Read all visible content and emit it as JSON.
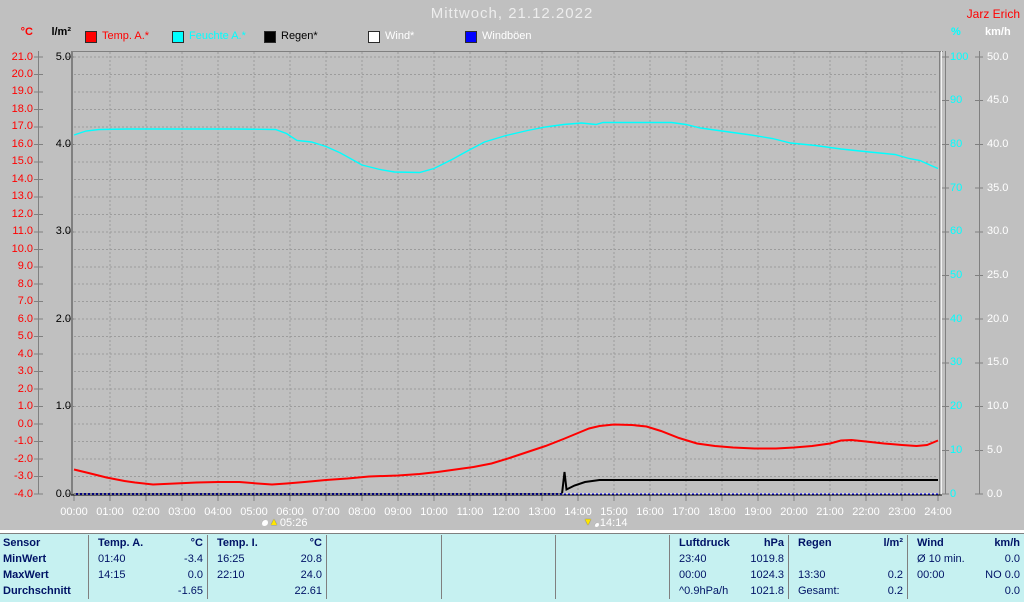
{
  "window": {
    "title_date": "Mittwoch, 21.12.2022",
    "station_label": "Jarz Erich"
  },
  "axis_units": {
    "left_temp": "°C",
    "left_rain": "l/m²",
    "right_humidity": "%",
    "right_wind": "km/h"
  },
  "legend": {
    "items": [
      {
        "label": "Temp. A.*",
        "swatch_color": "#ff0000",
        "text_color": "#ff0000"
      },
      {
        "label": "Feuchte A.*",
        "swatch_color": "#00ffff",
        "text_color": "#00ffff"
      },
      {
        "label": "Regen*",
        "swatch_color": "#000000",
        "text_color": "#000000"
      },
      {
        "label": "Wind*",
        "swatch_color": "#ffffff",
        "text_color": "#ffffff"
      },
      {
        "label": "Windböen",
        "swatch_color": "#0000ff",
        "text_color": "#ffffff"
      }
    ]
  },
  "markers": {
    "moonrise": {
      "time": "05:26"
    },
    "moonset": {
      "time": "14:14"
    }
  },
  "chart_data": {
    "type": "line",
    "title": "Mittwoch, 21.12.2022",
    "grid": true,
    "x_axis": {
      "unit": "time",
      "min_hour": 0,
      "max_hour": 24,
      "tick_labels": [
        "00:00",
        "01:00",
        "02:00",
        "03:00",
        "04:00",
        "05:00",
        "06:00",
        "07:00",
        "08:00",
        "09:00",
        "10:00",
        "11:00",
        "12:00",
        "13:00",
        "14:00",
        "15:00",
        "16:00",
        "17:00",
        "18:00",
        "19:00",
        "20:00",
        "21:00",
        "22:00",
        "23:00",
        "24:00"
      ]
    },
    "axes": {
      "temp_c": {
        "side": "left",
        "unit": "°C",
        "color": "#ff0000",
        "min": -4,
        "max": 21,
        "ticks": [
          "21.0",
          "20.0",
          "19.0",
          "18.0",
          "17.0",
          "16.0",
          "15.0",
          "14.0",
          "13.0",
          "12.0",
          "11.0",
          "10.0",
          "9.0",
          "8.0",
          "7.0",
          "6.0",
          "5.0",
          "4.0",
          "3.0",
          "2.0",
          "1.0",
          "0.0",
          "-1.0",
          "-2.0",
          "-3.0",
          "-4.0"
        ]
      },
      "rain_lm2": {
        "side": "left",
        "unit": "l/m²",
        "color": "#000000",
        "min": 0,
        "max": 5,
        "ticks": [
          "5.0",
          "4.0",
          "3.0",
          "2.0",
          "1.0",
          "0.0"
        ]
      },
      "humidity_pct": {
        "side": "right",
        "unit": "%",
        "color": "#00ffff",
        "min": 0,
        "max": 100,
        "ticks": [
          "100",
          "90",
          "80",
          "70",
          "60",
          "50",
          "40",
          "30",
          "20",
          "10",
          "0"
        ]
      },
      "wind_kmh": {
        "side": "right",
        "unit": "km/h",
        "color": "#ffffff",
        "min": 0,
        "max": 50,
        "ticks": [
          "50.0",
          "45.0",
          "40.0",
          "35.0",
          "30.0",
          "25.0",
          "20.0",
          "15.0",
          "10.0",
          "5.0",
          "0.0"
        ]
      }
    },
    "series": [
      {
        "name": "Feuchte A.*",
        "axis": "humidity_pct",
        "color": "#00ffff",
        "width": 1.4,
        "points": [
          [
            0,
            82.2
          ],
          [
            0.33,
            83.1
          ],
          [
            0.7,
            83.4
          ],
          [
            1.5,
            83.5
          ],
          [
            2.5,
            83.5
          ],
          [
            3.5,
            83.5
          ],
          [
            4.5,
            83.5
          ],
          [
            5.6,
            83.4
          ],
          [
            5.9,
            82.5
          ],
          [
            6.2,
            80.9
          ],
          [
            6.6,
            80.6
          ],
          [
            7.0,
            79.5
          ],
          [
            7.4,
            78.0
          ],
          [
            8.0,
            75.3
          ],
          [
            8.5,
            74.2
          ],
          [
            8.9,
            73.7
          ],
          [
            9.6,
            73.6
          ],
          [
            10.0,
            74.5
          ],
          [
            10.5,
            76.5
          ],
          [
            10.9,
            78.4
          ],
          [
            11.4,
            80.5
          ],
          [
            12.0,
            82.0
          ],
          [
            12.6,
            83.2
          ],
          [
            13.1,
            84.0
          ],
          [
            13.6,
            84.6
          ],
          [
            14.1,
            84.9
          ],
          [
            14.5,
            84.5
          ],
          [
            14.7,
            85.0
          ],
          [
            15.5,
            85.0
          ],
          [
            16.6,
            85.0
          ],
          [
            17.0,
            84.5
          ],
          [
            17.4,
            83.7
          ],
          [
            18.1,
            82.9
          ],
          [
            18.8,
            82.2
          ],
          [
            19.4,
            81.3
          ],
          [
            19.9,
            80.3
          ],
          [
            20.6,
            79.7
          ],
          [
            21.3,
            78.9
          ],
          [
            22.1,
            78.3
          ],
          [
            22.8,
            77.7
          ],
          [
            23.2,
            76.8
          ],
          [
            23.5,
            76.3
          ],
          [
            23.8,
            75.2
          ],
          [
            24,
            74.5
          ]
        ]
      },
      {
        "name": "Temp. A.*",
        "axis": "temp_c",
        "color": "#ff0000",
        "width": 2,
        "points": [
          [
            0,
            -2.6
          ],
          [
            0.4,
            -2.8
          ],
          [
            0.9,
            -3.05
          ],
          [
            1.4,
            -3.25
          ],
          [
            1.7,
            -3.35
          ],
          [
            2.2,
            -3.45
          ],
          [
            2.8,
            -3.4
          ],
          [
            3.4,
            -3.35
          ],
          [
            4.0,
            -3.3
          ],
          [
            4.6,
            -3.3
          ],
          [
            5.1,
            -3.4
          ],
          [
            5.5,
            -3.45
          ],
          [
            5.9,
            -3.4
          ],
          [
            6.4,
            -3.3
          ],
          [
            7.0,
            -3.2
          ],
          [
            7.6,
            -3.1
          ],
          [
            8.2,
            -3.0
          ],
          [
            9.0,
            -2.93
          ],
          [
            9.6,
            -2.85
          ],
          [
            10.1,
            -2.75
          ],
          [
            10.6,
            -2.6
          ],
          [
            11.1,
            -2.45
          ],
          [
            11.6,
            -2.25
          ],
          [
            12.1,
            -1.95
          ],
          [
            12.6,
            -1.6
          ],
          [
            13.1,
            -1.25
          ],
          [
            13.6,
            -0.85
          ],
          [
            14.0,
            -0.5
          ],
          [
            14.3,
            -0.25
          ],
          [
            14.6,
            -0.1
          ],
          [
            15.0,
            -0.03
          ],
          [
            15.5,
            -0.05
          ],
          [
            15.9,
            -0.15
          ],
          [
            16.3,
            -0.4
          ],
          [
            16.8,
            -0.8
          ],
          [
            17.3,
            -1.1
          ],
          [
            17.8,
            -1.25
          ],
          [
            18.3,
            -1.35
          ],
          [
            18.9,
            -1.4
          ],
          [
            19.5,
            -1.4
          ],
          [
            20.0,
            -1.35
          ],
          [
            20.5,
            -1.25
          ],
          [
            21.0,
            -1.1
          ],
          [
            21.3,
            -0.95
          ],
          [
            21.6,
            -0.9
          ],
          [
            22.0,
            -1.0
          ],
          [
            22.5,
            -1.1
          ],
          [
            23.0,
            -1.2
          ],
          [
            23.4,
            -1.25
          ],
          [
            23.7,
            -1.2
          ],
          [
            24,
            -0.95
          ]
        ]
      },
      {
        "name": "Regen*",
        "axis": "rain_lm2",
        "color": "#000000",
        "width": 2,
        "points": [
          [
            0,
            0
          ],
          [
            13.55,
            0
          ],
          [
            13.62,
            0.25
          ],
          [
            13.68,
            0.05
          ],
          [
            13.9,
            0.1
          ],
          [
            14.2,
            0.14
          ],
          [
            14.6,
            0.16
          ],
          [
            15.0,
            0.16
          ],
          [
            24,
            0.16
          ]
        ]
      },
      {
        "name": "Windböen",
        "axis": "wind_kmh",
        "color": "#0000ff",
        "width": 1,
        "points": [
          [
            0,
            0
          ],
          [
            24,
            0
          ]
        ]
      },
      {
        "name": "Wind*",
        "axis": "wind_kmh",
        "color": "#ffffff",
        "width": 1,
        "dash": "2 2",
        "points": [
          [
            0,
            0
          ],
          [
            24,
            0
          ]
        ]
      }
    ],
    "markers": [
      {
        "type": "moonrise",
        "time": "05:26",
        "x_hour": 5.43
      },
      {
        "type": "moonset",
        "time": "14:14",
        "x_hour": 14.23
      }
    ]
  },
  "stats_table": {
    "row_labels": [
      "Sensor",
      "MinWert",
      "MaxWert",
      "Durchschnitt"
    ],
    "columns": [
      {
        "name": "Temp. A.",
        "unit": "°C",
        "min_time": "01:40",
        "min_value": "-3.4",
        "max_time": "14:15",
        "max_value": "0.0",
        "avg_label": "",
        "avg_value": "-1.65"
      },
      {
        "name": "Temp. I.",
        "unit": "°C",
        "min_time": "16:25",
        "min_value": "20.8",
        "max_time": "22:10",
        "max_value": "24.0",
        "avg_label": "",
        "avg_value": "22.61"
      },
      {
        "name": "",
        "unit": "",
        "min_time": "",
        "min_value": "",
        "max_time": "",
        "max_value": "",
        "avg_label": "",
        "avg_value": ""
      },
      {
        "name": "",
        "unit": "",
        "min_time": "",
        "min_value": "",
        "max_time": "",
        "max_value": "",
        "avg_label": "",
        "avg_value": ""
      },
      {
        "name": "",
        "unit": "",
        "min_time": "",
        "min_value": "",
        "max_time": "",
        "max_value": "",
        "avg_label": "",
        "avg_value": ""
      },
      {
        "name": "Luftdruck",
        "unit": "hPa",
        "min_time": "23:40",
        "min_value": "1019.8",
        "max_time": "00:00",
        "max_value": "1024.3",
        "avg_label": "^0.9hPa/h",
        "avg_value": "1021.8"
      },
      {
        "name": "Regen",
        "unit": "l/m²",
        "min_time": "",
        "min_value": "",
        "max_time": "13:30",
        "max_value": "0.2",
        "avg_label": "Gesamt:",
        "avg_value": "0.2"
      },
      {
        "name": "Wind",
        "unit": "km/h",
        "min_time": "Ø 10 min.",
        "min_value": "0.0",
        "max_time": "00:00",
        "max_value": "NO 0.0",
        "avg_label": "",
        "avg_value": "0.0"
      }
    ]
  },
  "colors": {
    "background": "#c0c0c0",
    "grid": "#9c9c9c",
    "axis_border": "#808080",
    "axis_bottom": "#000000",
    "title_text": "#ededed",
    "station_text": "#ff0000",
    "xlabel_text": "#ffffff",
    "table_background": "#c6f1f1",
    "table_text": "#001366"
  }
}
